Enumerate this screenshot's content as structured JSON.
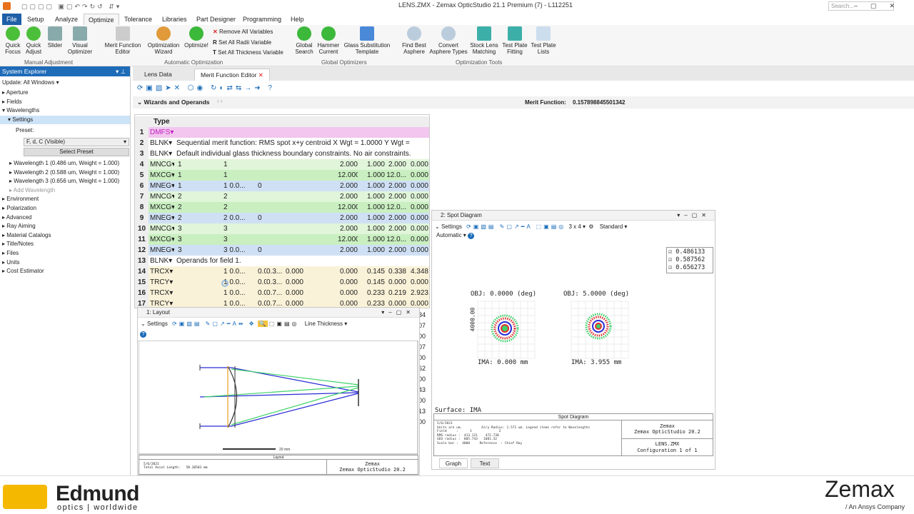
{
  "window": {
    "title": "LENS.ZMX - Zemax OpticStudio 21.1   Premium (7) - L112251",
    "search_placeholder": "Search..."
  },
  "menu": [
    "File",
    "Setup",
    "Analyze",
    "Optimize",
    "Tolerance",
    "Libraries",
    "Part Designer",
    "Programming",
    "Help"
  ],
  "ribbon": {
    "manual": [
      "Quick Focus",
      "Quick Adjust",
      "Slider",
      "Visual Optimizer"
    ],
    "manual_group": "Manual Adjustment",
    "auto": [
      "Merit Function Editor",
      "Optimization Wizard",
      "Optimize!"
    ],
    "auto_small": [
      "Remove All Variables",
      "Set All Radii Variable",
      "Set All Thickness Variable"
    ],
    "auto_group": "Automatic Optimization",
    "global": [
      "Global Search",
      "Hammer Current",
      "Glass Substitution Template"
    ],
    "global_group": "Global Optimizers",
    "tools": [
      "Find Best Asphere",
      "Convert Asphere Types",
      "Stock Lens Matching",
      "Test Plate Fitting",
      "Test Plate Lists"
    ],
    "tools_group": "Optimization Tools"
  },
  "sysexp": {
    "title": "System Explorer",
    "update": "Update: All Windows",
    "items_top": [
      "Aperture",
      "Fields",
      "Wavelengths"
    ],
    "settings": "Settings",
    "preset_label": "Preset:",
    "preset_value": "F, d, C (Visible)",
    "select_preset": "Select Preset",
    "wavelengths": [
      "Wavelength 1 (0.486 um, Weight = 1.000)",
      "Wavelength 2 (0.588 um, Weight = 1.000)",
      "Wavelength 3 (0.656 um, Weight = 1.000)"
    ],
    "add_wavelength": "Add Wavelength",
    "items_bottom": [
      "Environment",
      "Polarization",
      "Advanced",
      "Ray Aiming",
      "Material Catalogs",
      "Title/Notes",
      "Files",
      "Units",
      "Cost Estimator"
    ]
  },
  "tabs": [
    "Lens Data",
    "Merit Function Editor"
  ],
  "mfe": {
    "wizards": "Wizards and Operands",
    "merit_label": "Merit Function:",
    "merit_value": "0.157898845501342",
    "type_header": "Type",
    "rows": [
      {
        "n": "1",
        "t": "DMFS",
        "c": [
          "",
          "",
          "",
          "",
          "",
          "",
          "",
          ""
        ],
        "bg": "#f2c6ee"
      },
      {
        "n": "2",
        "t": "BLNK",
        "c": [
          "Sequential merit function: RMS spot x+y centroid X Wgt = 1.0000 Y Wgt = ",
          "",
          "",
          "",
          "",
          "",
          "",
          ""
        ],
        "bg": "#fff",
        "wide": true
      },
      {
        "n": "3",
        "t": "BLNK",
        "c": [
          "Default individual glass thickness boundary constraints. No air constraints.",
          "",
          "",
          "",
          "",
          "",
          "",
          ""
        ],
        "bg": "#fff",
        "wide": true
      },
      {
        "n": "4",
        "t": "MNCG",
        "c": [
          "1",
          "1",
          "",
          "",
          "",
          "2.000",
          "1.000",
          "2.000",
          "0.000"
        ],
        "bg": "#e0f5d9"
      },
      {
        "n": "5",
        "t": "MXCG",
        "c": [
          "1",
          "1",
          "",
          "",
          "",
          "12.000",
          "1.000",
          "12.0...",
          "0.000"
        ],
        "bg": "#c9efc0"
      },
      {
        "n": "6",
        "t": "MNEG",
        "c": [
          "1",
          "1 0.0...",
          "0",
          "",
          "",
          "2.000",
          "1.000",
          "2.000",
          "0.000"
        ],
        "bg": "#cfe0f5"
      },
      {
        "n": "7",
        "t": "MNCG",
        "c": [
          "2",
          "2",
          "",
          "",
          "",
          "2.000",
          "1.000",
          "2.000",
          "0.000"
        ],
        "bg": "#e0f5d9"
      },
      {
        "n": "8",
        "t": "MXCG",
        "c": [
          "2",
          "2",
          "",
          "",
          "",
          "12.000",
          "1.000",
          "12.0...",
          "0.000"
        ],
        "bg": "#c9efc0"
      },
      {
        "n": "9",
        "t": "MNEG",
        "c": [
          "2",
          "2 0.0...",
          "0",
          "",
          "",
          "2.000",
          "1.000",
          "2.000",
          "0.000"
        ],
        "bg": "#cfe0f5"
      },
      {
        "n": "10",
        "t": "MNCG",
        "c": [
          "3",
          "3",
          "",
          "",
          "",
          "2.000",
          "1.000",
          "2.000",
          "0.000"
        ],
        "bg": "#e0f5d9"
      },
      {
        "n": "11",
        "t": "MXCG",
        "c": [
          "3",
          "3",
          "",
          "",
          "",
          "12.000",
          "1.000",
          "12.0...",
          "0.000"
        ],
        "bg": "#c9efc0"
      },
      {
        "n": "12",
        "t": "MNEG",
        "c": [
          "3",
          "3 0.0...",
          "0",
          "",
          "",
          "2.000",
          "1.000",
          "2.000",
          "0.000"
        ],
        "bg": "#cfe0f5"
      },
      {
        "n": "13",
        "t": "BLNK",
        "c": [
          "Operands for field 1.",
          "",
          "",
          "",
          "",
          "",
          "",
          ""
        ],
        "bg": "#fff",
        "wide": true
      },
      {
        "n": "14",
        "t": "TRCX",
        "c": [
          "",
          "1 0.0...",
          "0.0...",
          "0.3...",
          "0.000",
          "0.000",
          "0.145",
          "0.338",
          "4.348"
        ],
        "bg": "#faf2d8"
      },
      {
        "n": "15",
        "t": "TRCY",
        "c": [
          "",
          "1 0.0...",
          "0.0...",
          "0.3...",
          "0.000",
          "0.000",
          "0.145",
          "0.000",
          "0.000"
        ],
        "bg": "#faf2d8"
      },
      {
        "n": "16",
        "t": "TRCX",
        "c": [
          "",
          "1 0.0...",
          "0.0...",
          "0.7...",
          "0.000",
          "0.000",
          "0.233",
          "0.219",
          "2.923"
        ],
        "bg": "#faf2d8"
      },
      {
        "n": "17",
        "t": "TRCY",
        "c": [
          "",
          "1 0.0...",
          "0.0...",
          "0.7...",
          "0.000",
          "0.000",
          "0.233",
          "0.000",
          "0.000"
        ],
        "bg": "#faf2d8"
      }
    ],
    "side_numbers": [
      "34",
      "07",
      "00",
      "07",
      "00",
      "62",
      "00",
      "43",
      "00",
      "13",
      "00"
    ]
  },
  "spot": {
    "title": "2: Spot Diagram",
    "settings": "Settings",
    "grid": "3 x 4",
    "mode": "Standard",
    "automatic": "Automatic",
    "legend": [
      "0.486133",
      "0.587562",
      "0.656273"
    ],
    "obj1": "OBJ: 0.0000 (deg)",
    "obj2": "OBJ: 5.0000 (deg)",
    "ima1": "IMA: 0.000 mm",
    "ima2": "IMA: 3.955 mm",
    "scale": "4000.00",
    "surface": "Surface: IMA",
    "footer_title": "Spot Diagram",
    "footer_text": "5/6/2021\nUnits are um.          Airy Radius: 1.572 um. Legend items refer to Wavelengths\nField     :      1              2\nRMS radius :  413.121    472.730\nGEO radius :  805.743   1081.32\nScale bar :  4000     Reference  : Chief Ray",
    "zemax": "Zemax",
    "version": "Zemax OpticStudio 20.2",
    "file": "LENS.ZMX",
    "config": "Configuration 1 of 1",
    "tab_graph": "Graph",
    "tab_text": "Text"
  },
  "layout_win": {
    "title": "1: Layout",
    "settings": "Settings",
    "line_thickness": "Line Thickness",
    "scale_label": "20 mm",
    "footer_left": "5/6/2021\nTotal Axial Length:   58.36501 mm",
    "footer_title": "Layout",
    "zemax": "Zemax",
    "version": "Zemax OpticStudio 20.2"
  },
  "footer": {
    "edmund": "Edmund",
    "edmund_sub": "optics | worldwide",
    "zemax": "Zemax",
    "zemax_sub": "/ An Ansys Company"
  },
  "colors": {
    "accent": "#1f5fa8",
    "blue": "#2b2bd6",
    "green": "#3fd26a",
    "red": "#e03030"
  }
}
